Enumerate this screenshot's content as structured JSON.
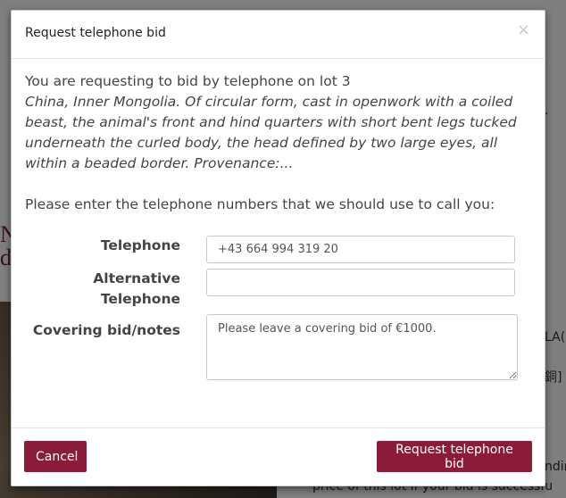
{
  "background": {
    "left_fragment_1": "N",
    "left_fragment_2": "di",
    "right_fragment_1": "LA(",
    "right_fragment_2": "銅]",
    "right_fragment_3": "·",
    "right_fragment_4": "ndir",
    "bottom_fragment": "price of this lot if your bid is successfu"
  },
  "modal": {
    "title": "Request telephone bid",
    "close_symbol": "×",
    "intro": "You are requesting to bid by telephone on lot 3",
    "lot_description": "China, Inner Mongolia. Of circular form, cast in openwork with a coiled beast, the animal's front and hind quarters with short bent legs tucked underneath the curled body, the head defined by two large eyes, all within a beaded border. Provenance:...",
    "prompt": "Please enter the telephone numbers that we should use to call you:",
    "fields": {
      "telephone_label": "Telephone",
      "telephone_value": "+43 664 994 319 20",
      "alt_telephone_label_line1": "Alternative",
      "alt_telephone_label_line2": "Telephone",
      "alt_telephone_value": "",
      "notes_label": "Covering bid/notes",
      "notes_value": "Please leave a covering bid of €1000."
    },
    "buttons": {
      "cancel": "Cancel",
      "submit": "Request telephone bid"
    }
  },
  "colors": {
    "accent": "#8a1c3a"
  }
}
